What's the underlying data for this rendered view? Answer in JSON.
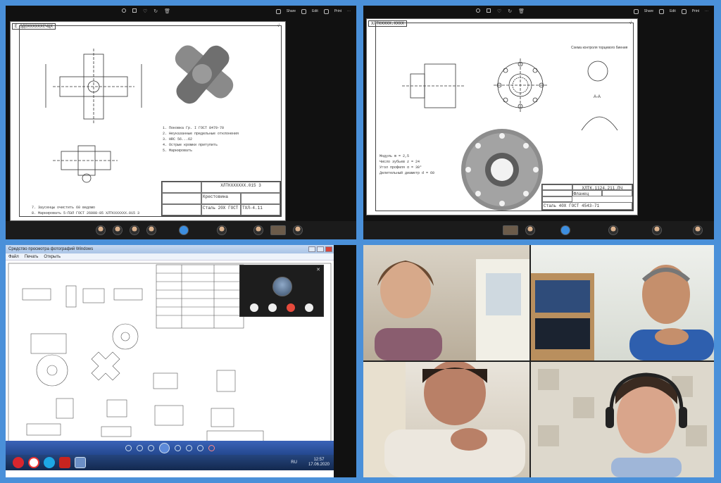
{
  "viewer_toolbar": {
    "share_label": "Share",
    "edit_label": "Edit",
    "print_label": "Print"
  },
  "drawing1": {
    "stamp_code": "Е ЗДОХХХХХХСЧЦХ",
    "title_code": "ХЛТКХХХХХХ.015 3",
    "part_name": "Крестовина",
    "material": "Сталь 20Х ГОСТ 4543-71",
    "sheet_label": "ТХЛ-4.11",
    "notes": [
      "1. Поковка Гр. I ГОСТ 8479-70",
      "2. Неуказанные предельные отклонения",
      "3. HRC 56...62",
      "4. Острые кромки притупить",
      "5. Маркировать"
    ],
    "bottom_notes": [
      "7. Заусенцы очистить 60 ведомо",
      "8. Маркировать 5-ПЭЛ ГОСТ 26008-85 ХЛТКХХХХХХ.015 3"
    ]
  },
  "drawing2": {
    "stamp_code": "ХЛТКХХХХ.ХХХХ",
    "title_code": "ХЛТК.1124.211.ПЧ",
    "part_name": "Фланец",
    "section_label": "Схема контроля торцевого биения",
    "section_a": "A-A",
    "bottom_label": "Сталь 40Х ГОСТ 4543-71",
    "table_rows": [
      "Модуль m = 2,5",
      "Число зубьев z = 24",
      "Угол профиля α = 30°",
      "Делительный диаметр d = 60"
    ]
  },
  "windows_app": {
    "window_title": "Средство просмотра фотографий Windows",
    "menu_file": "Файл",
    "menu_print": "Печать",
    "menu_open": "Открыть",
    "lang": "RU",
    "time": "12:57",
    "date": "17.06.2020"
  }
}
